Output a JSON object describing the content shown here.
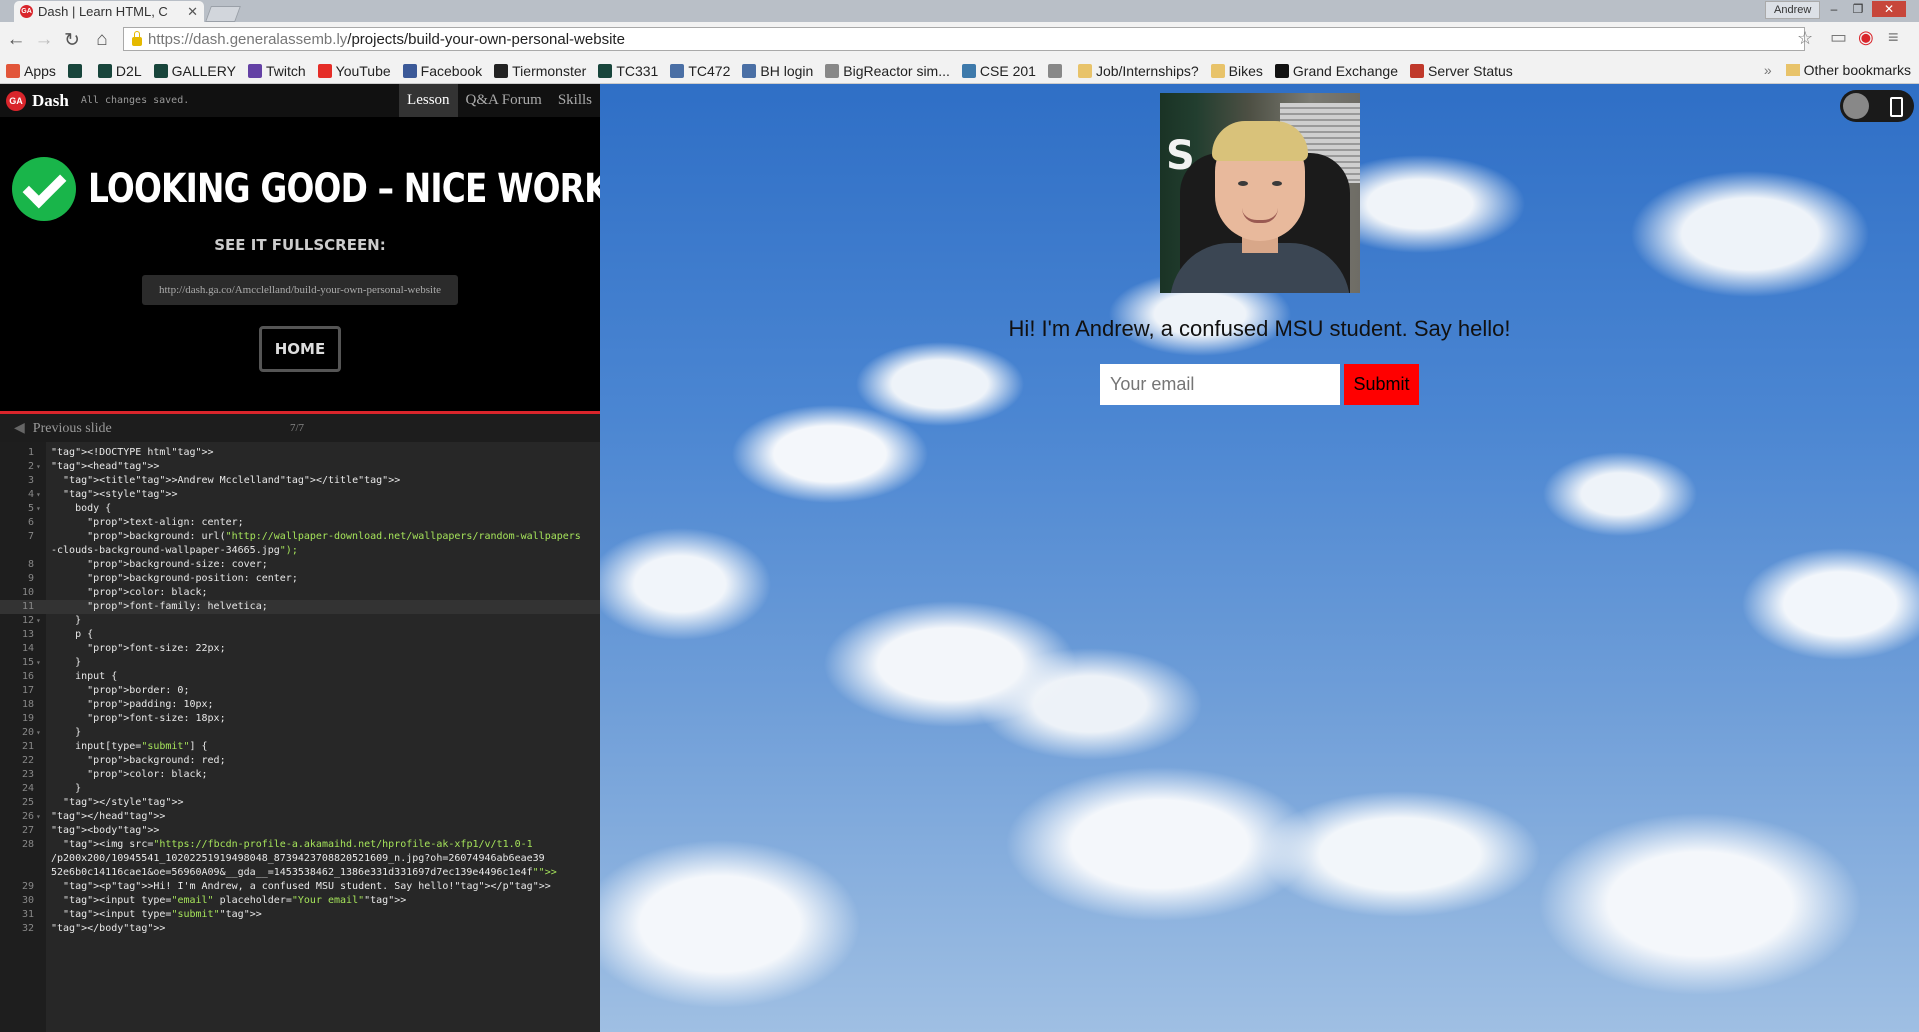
{
  "browser": {
    "tab_title": "Dash | Learn HTML, C",
    "tab_favicon": "GA",
    "user": "Andrew",
    "url_host": "https://dash.generalassemb.ly",
    "url_path": "/projects/build-your-own-personal-website"
  },
  "bookmarks": [
    {
      "label": "Apps",
      "icon": "apps-grid-icon",
      "color": "#e2563a"
    },
    {
      "label": "",
      "icon": "msu-spartan-icon",
      "color": "#18453b"
    },
    {
      "label": "D2L",
      "icon": "d2l-icon",
      "color": "#18453b"
    },
    {
      "label": "GALLERY",
      "icon": "msu-spartan-icon",
      "color": "#18453b"
    },
    {
      "label": "Twitch",
      "icon": "twitch-icon",
      "color": "#6441a5"
    },
    {
      "label": "YouTube",
      "icon": "youtube-icon",
      "color": "#e52d27"
    },
    {
      "label": "Facebook",
      "icon": "facebook-icon",
      "color": "#3b5998"
    },
    {
      "label": "Tiermonster",
      "icon": "tiermonster-icon",
      "color": "#222222"
    },
    {
      "label": "TC331",
      "icon": "msu-spartan-icon",
      "color": "#18453b"
    },
    {
      "label": "TC472",
      "icon": "grid-icon",
      "color": "#4a6fa5"
    },
    {
      "label": "BH login",
      "icon": "grid-icon",
      "color": "#4a6fa5"
    },
    {
      "label": "BigReactor sim...",
      "icon": "page-icon",
      "color": "#888888"
    },
    {
      "label": "CSE 201",
      "icon": "piazza-icon",
      "color": "#3e7aab"
    },
    {
      "label": "",
      "icon": "page-icon",
      "color": "#888888"
    },
    {
      "label": "Job/Internships?",
      "icon": "folder-icon",
      "color": "#e8c36a"
    },
    {
      "label": "Bikes",
      "icon": "folder-icon",
      "color": "#e8c36a"
    },
    {
      "label": "Grand Exchange",
      "icon": "runescape-icon",
      "color": "#111111"
    },
    {
      "label": "Server Status",
      "icon": "server-icon",
      "color": "#c0392b"
    }
  ],
  "other_bookmarks": "Other bookmarks",
  "dash": {
    "logo": "GA",
    "name": "Dash",
    "status": "All changes saved.",
    "tabs": [
      "Lesson",
      "Q&A Forum",
      "Skills"
    ],
    "headline": "LOOKING GOOD – NICE WORK!",
    "see_fullscreen": "SEE IT FULLSCREEN:",
    "short_link": "http://dash.ga.co/Amcclelland/build-your-own-personal-website",
    "home_button": "HOME",
    "previous_slide": "Previous slide",
    "slide_count": "7/7"
  },
  "code_lines": [
    "1",
    "2",
    "3",
    "4",
    "5",
    "6",
    "7",
    "",
    "8",
    "9",
    "10",
    "11",
    "12",
    "13",
    "14",
    "15",
    "16",
    "17",
    "18",
    "19",
    "20",
    "21",
    "22",
    "23",
    "24",
    "25",
    "26",
    "27",
    "28",
    "",
    "",
    "29",
    "30",
    "31",
    "32"
  ],
  "code_text": [
    "<!DOCTYPE html>",
    "<head>",
    "  <title>Andrew Mcclelland</title>",
    "  <style>",
    "    body {",
    "      text-align: center;",
    "      background: url(\"http://wallpaper-download.net/wallpapers/random-wallpapers",
    "-clouds-background-wallpaper-34665.jpg\");",
    "      background-size: cover;",
    "      background-position: center;",
    "      color: black;",
    "      font-family: helvetica;",
    "    }",
    "    p {",
    "      font-size: 22px;",
    "    }",
    "    input {",
    "      border: 0;",
    "      padding: 10px;",
    "      font-size: 18px;",
    "    }",
    "    input[type=\"submit\"] {",
    "      background: red;",
    "      color: black;",
    "    }",
    "  </style>",
    "</head>",
    "<body>",
    "  <img src=\"https://fbcdn-profile-a.akamaihd.net/hprofile-ak-xfp1/v/t1.0-1",
    "/p200x200/10945541_10202251919498048_8739423708820521609_n.jpg?oh=26074946ab6eae39",
    "52e6b0c14116cae1&oe=56960A09&__gda__=1453538462_1386e331d331697d7ec139e4496c1e4f\">",
    "  <p>Hi! I'm Andrew, a confused MSU student. Say hello!</p>",
    "  <input type=\"email\" placeholder=\"Your email\">",
    "  <input type=\"submit\">",
    "</body>"
  ],
  "site": {
    "greeting": "Hi! I'm Andrew, a confused MSU student. Say hello!",
    "email_placeholder": "Your email",
    "submit_label": "Submit",
    "shirt_letter": "S"
  },
  "colors": {
    "ga_red": "#d9252b",
    "success_green": "#19b54a",
    "submit_red": "#ff0000"
  }
}
